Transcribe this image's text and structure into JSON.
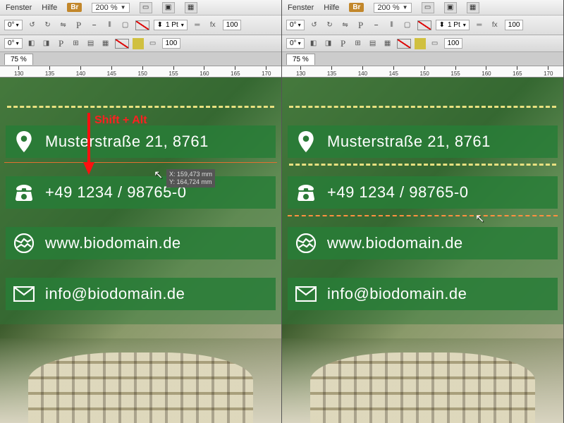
{
  "menu": {
    "fenster": "Fenster",
    "hilfe": "Hilfe",
    "br": "Br",
    "zoom": "200 %"
  },
  "toolbar": {
    "deg": "0°",
    "pt": "1 Pt",
    "pct": "100"
  },
  "tab": {
    "left": "75 %",
    "right": "75 %"
  },
  "ruler": [
    "130",
    "135",
    "140",
    "145",
    "150",
    "155",
    "160",
    "165",
    "170"
  ],
  "contacts": {
    "address": "Musterstraße 21, 8761",
    "phone": "+49 1234 / 98765-0",
    "web": "www.biodomain.de",
    "email": "info@biodomain.de"
  },
  "annotation": {
    "label": "Shift + Alt"
  },
  "coords": {
    "x": "X: 159,473 mm",
    "y": "Y: 164,724 mm"
  }
}
